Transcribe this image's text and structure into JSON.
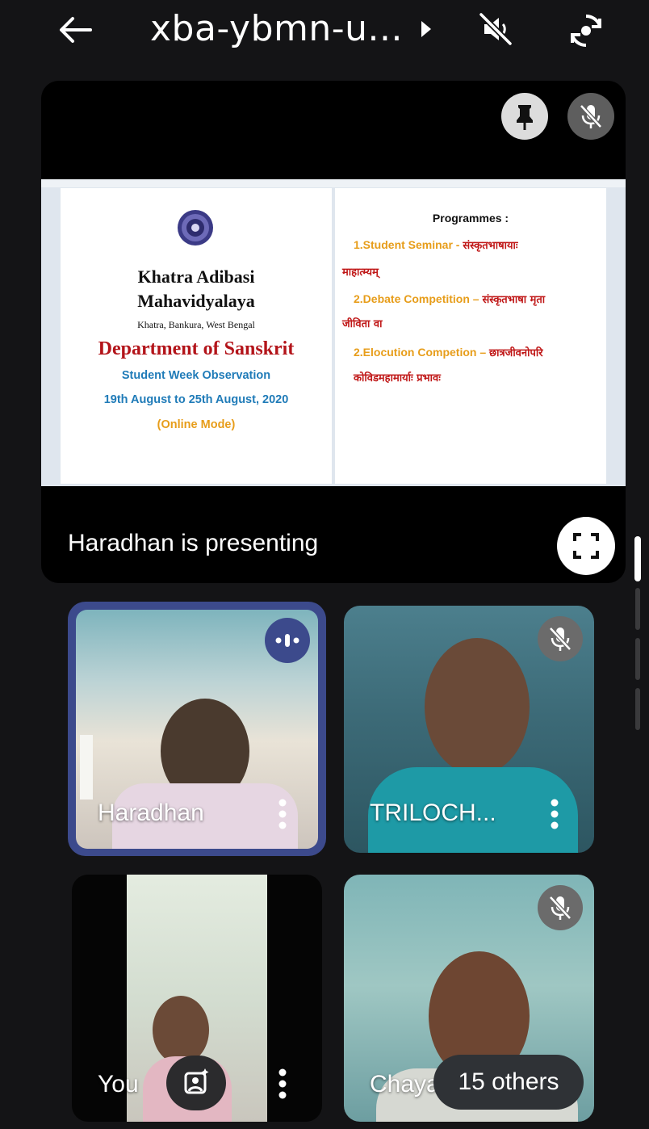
{
  "header": {
    "meeting_code": "xba-ybmn-u...",
    "icons": {
      "back": "back-arrow-icon",
      "expand": "caret-right-icon",
      "speaker": "speaker-off-icon",
      "camera": "flip-camera-icon"
    }
  },
  "presentation": {
    "status_text": "Haradhan is presenting",
    "slide": {
      "left": {
        "college_line1": "Khatra Adibasi",
        "college_line2": "Mahavidyalaya",
        "address": "Khatra, Bankura, West Bengal",
        "department": "Department of Sanskrit",
        "event": "Student Week Observation",
        "dates": "19th August to 25th August, 2020",
        "mode": "(Online Mode)"
      },
      "right": {
        "heading": "Programmes :",
        "item1_label": "1.Student Seminar - ",
        "item1_topic_a": "संस्कृतभाषायाः",
        "item1_topic_b": "माहात्म्यम्",
        "item2_label": "2.Debate Competition – ",
        "item2_topic_a": "संस्कृतभाषा मृता",
        "item2_topic_b": "जीविता वा",
        "item3_label": "2.Elocution Competion – ",
        "item3_topic_a": "छात्रजीवनोपरि",
        "item3_topic_b": "कोविडमहामार्याः प्रभावः"
      }
    }
  },
  "participants": [
    {
      "name": "Haradhan",
      "state": "speaking"
    },
    {
      "name": "TRILOCH...",
      "state": "muted"
    },
    {
      "name": "You",
      "state": "self"
    },
    {
      "name": "Chayan",
      "state": "muted"
    }
  ],
  "others_chip": "15 others",
  "colors": {
    "accent": "#3c4a8c",
    "red": "#c01818",
    "orange": "#e79d1a",
    "blue": "#1f7bb8"
  }
}
